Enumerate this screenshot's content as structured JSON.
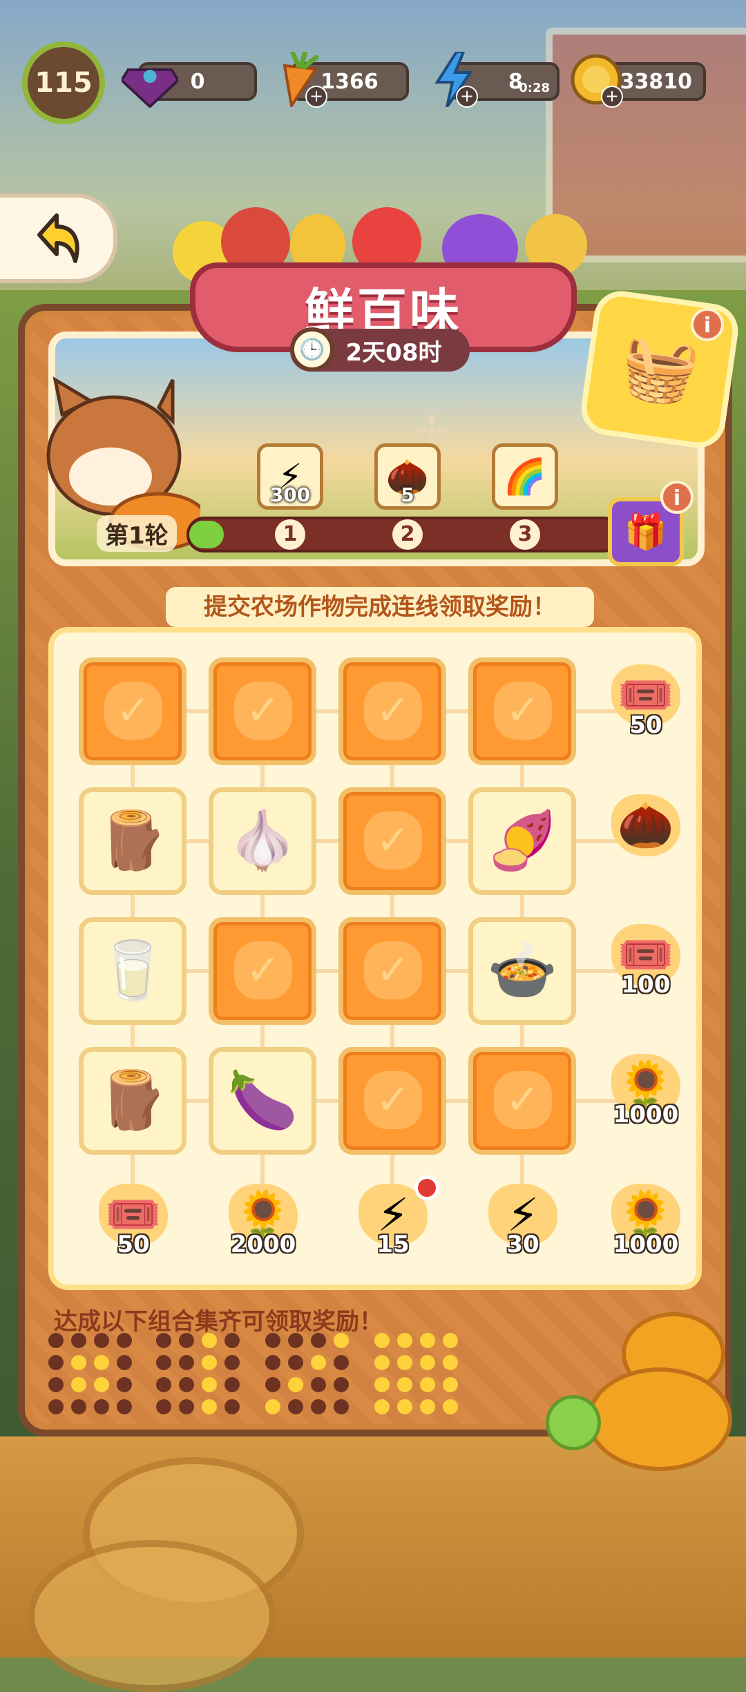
{
  "hud": {
    "level": "115",
    "gems": {
      "value": "0",
      "icon": "gem-icon"
    },
    "carrots": {
      "value": "1366",
      "icon": "carrot-icon"
    },
    "energy": {
      "value": "8",
      "timer": "0:28",
      "icon": "lightning-icon"
    },
    "coins": {
      "value": "33810",
      "icon": "coin-icon"
    }
  },
  "event": {
    "title": "鲜百味",
    "time_left": "2天08时",
    "round_label": "第1轮",
    "instruction": "提交农场作物完成连线领取奖励！",
    "combo_label": "达成以下组合集齐可领取奖励！"
  },
  "milestones": [
    {
      "num": "1",
      "amount": "300",
      "icon": "lightning-icon"
    },
    {
      "num": "2",
      "amount": "5",
      "icon": "acorn-icon"
    },
    {
      "num": "3",
      "amount": "",
      "icon": "rainbow-icon"
    }
  ],
  "progress": {
    "fraction": 0.08
  },
  "grid": {
    "rows": [
      [
        "done",
        "done",
        "done",
        "done"
      ],
      [
        "yam",
        "garlic",
        "done",
        "sweet-potato"
      ],
      [
        "juice",
        "done",
        "done",
        "purple-dish"
      ],
      [
        "yam",
        "purple-potato",
        "done",
        "done"
      ]
    ],
    "row_rewards": [
      {
        "amount": "50",
        "icon": "ticket-icon"
      },
      {
        "amount": "",
        "icon": "acorn-icon"
      },
      {
        "amount": "100",
        "icon": "ticket-icon"
      },
      {
        "amount": "1000",
        "icon": "seed-icon"
      }
    ],
    "col_rewards": [
      {
        "amount": "50",
        "icon": "ticket-icon"
      },
      {
        "amount": "2000",
        "icon": "seed-icon"
      },
      {
        "amount": "15",
        "icon": "lightning-icon"
      },
      {
        "amount": "30",
        "icon": "lightning-icon"
      },
      {
        "amount": "1000",
        "icon": "seed-icon"
      }
    ]
  },
  "combos": [
    [
      0,
      0,
      0,
      0,
      0,
      1,
      1,
      0,
      0,
      1,
      1,
      0,
      0,
      0,
      0,
      0
    ],
    [
      0,
      0,
      1,
      0,
      0,
      0,
      1,
      0,
      0,
      0,
      1,
      0,
      0,
      0,
      1,
      0
    ],
    [
      0,
      0,
      0,
      1,
      0,
      0,
      1,
      0,
      0,
      1,
      0,
      0,
      1,
      0,
      0,
      0
    ],
    [
      1,
      1,
      1,
      1,
      1,
      1,
      1,
      1,
      1,
      1,
      1,
      1,
      1,
      1,
      1,
      1
    ]
  ],
  "colors": {
    "accent": "#ff9a33",
    "ribbon": "#e15d6c",
    "progress": "#7fd03e"
  }
}
